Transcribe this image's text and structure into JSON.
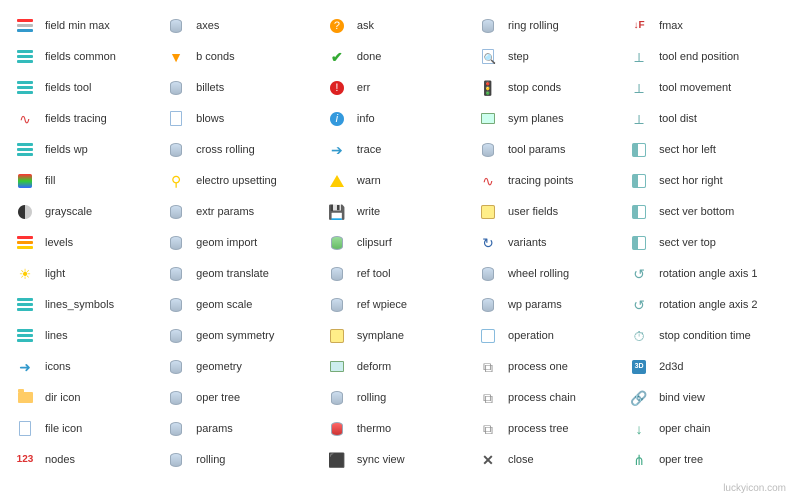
{
  "watermark": "luckyicon.com",
  "columns": [
    [
      {
        "icon": "field-min-max-icon",
        "label": "field min max"
      },
      {
        "icon": "fields-common-icon",
        "label": "fields common"
      },
      {
        "icon": "fields-tool-icon",
        "label": "fields tool"
      },
      {
        "icon": "fields-tracing-icon",
        "label": "fields tracing"
      },
      {
        "icon": "fields-wp-icon",
        "label": "fields wp"
      },
      {
        "icon": "fill-icon",
        "label": "fill"
      },
      {
        "icon": "grayscale-icon",
        "label": "grayscale"
      },
      {
        "icon": "levels-icon",
        "label": "levels"
      },
      {
        "icon": "light-icon",
        "label": "light"
      },
      {
        "icon": "lines-symbols-icon",
        "label": "lines_symbols"
      },
      {
        "icon": "lines-icon",
        "label": "lines"
      },
      {
        "icon": "icons-icon",
        "label": "icons"
      },
      {
        "icon": "dir-icon",
        "label": "dir icon"
      },
      {
        "icon": "file-icon",
        "label": "file icon"
      },
      {
        "icon": "nodes-icon",
        "label": "nodes"
      }
    ],
    [
      {
        "icon": "axes-icon",
        "label": "axes"
      },
      {
        "icon": "b-conds-icon",
        "label": "b conds"
      },
      {
        "icon": "billets-icon",
        "label": "billets"
      },
      {
        "icon": "blows-icon",
        "label": "blows"
      },
      {
        "icon": "cross-rolling-icon",
        "label": "cross rolling"
      },
      {
        "icon": "electro-upsetting-icon",
        "label": "electro upsetting"
      },
      {
        "icon": "extr-params-icon",
        "label": "extr params"
      },
      {
        "icon": "geom-import-icon",
        "label": "geom import"
      },
      {
        "icon": "geom-translate-icon",
        "label": "geom translate"
      },
      {
        "icon": "geom-scale-icon",
        "label": "geom scale"
      },
      {
        "icon": "geom-symmetry-icon",
        "label": "geom symmetry"
      },
      {
        "icon": "geometry-icon",
        "label": "geometry"
      },
      {
        "icon": "oper-tree-icon",
        "label": "oper tree"
      },
      {
        "icon": "params-icon",
        "label": "params"
      },
      {
        "icon": "rolling-icon",
        "label": "rolling"
      }
    ],
    [
      {
        "icon": "ask-icon",
        "label": "ask"
      },
      {
        "icon": "done-icon",
        "label": "done"
      },
      {
        "icon": "err-icon",
        "label": "err"
      },
      {
        "icon": "info-icon",
        "label": "info"
      },
      {
        "icon": "trace-icon",
        "label": "trace"
      },
      {
        "icon": "warn-icon",
        "label": "warn"
      },
      {
        "icon": "write-icon",
        "label": "write"
      },
      {
        "icon": "clipsurf-icon",
        "label": "clipsurf"
      },
      {
        "icon": "ref-tool-icon",
        "label": "ref tool"
      },
      {
        "icon": "ref-wpiece-icon",
        "label": "ref wpiece"
      },
      {
        "icon": "symplane-icon",
        "label": "symplane"
      },
      {
        "icon": "deform-icon",
        "label": "deform"
      },
      {
        "icon": "rolling-2-icon",
        "label": "rolling"
      },
      {
        "icon": "thermo-icon",
        "label": "thermo"
      },
      {
        "icon": "sync-view-icon",
        "label": "sync view"
      }
    ],
    [
      {
        "icon": "ring-rolling-icon",
        "label": "ring rolling"
      },
      {
        "icon": "step-icon",
        "label": "step"
      },
      {
        "icon": "stop-conds-icon",
        "label": "stop conds"
      },
      {
        "icon": "sym-planes-icon",
        "label": "sym planes"
      },
      {
        "icon": "tool-params-icon",
        "label": "tool params"
      },
      {
        "icon": "tracing-points-icon",
        "label": "tracing points"
      },
      {
        "icon": "user-fields-icon",
        "label": "user fields"
      },
      {
        "icon": "variants-icon",
        "label": "variants"
      },
      {
        "icon": "wheel-rolling-icon",
        "label": "wheel rolling"
      },
      {
        "icon": "wp-params-icon",
        "label": "wp params"
      },
      {
        "icon": "operation-icon",
        "label": "operation"
      },
      {
        "icon": "process-one-icon",
        "label": "process one"
      },
      {
        "icon": "process-chain-icon",
        "label": "process chain"
      },
      {
        "icon": "process-tree-icon",
        "label": "process tree"
      },
      {
        "icon": "close-icon",
        "label": "close"
      }
    ],
    [
      {
        "icon": "fmax-icon",
        "label": "fmax"
      },
      {
        "icon": "tool-end-position-icon",
        "label": "tool end position"
      },
      {
        "icon": "tool-movement-icon",
        "label": "tool movement"
      },
      {
        "icon": "tool-dist-icon",
        "label": "tool dist"
      },
      {
        "icon": "sect-hor-left-icon",
        "label": "sect hor left"
      },
      {
        "icon": "sect-hor-right-icon",
        "label": "sect hor right"
      },
      {
        "icon": "sect-ver-bottom-icon",
        "label": "sect ver bottom"
      },
      {
        "icon": "sect-ver-top-icon",
        "label": "sect ver top"
      },
      {
        "icon": "rotation-angle-axis-1-icon",
        "label": "rotation angle axis 1"
      },
      {
        "icon": "rotation-angle-axis-2-icon",
        "label": "rotation angle axis 2"
      },
      {
        "icon": "stop-condition-time-icon",
        "label": "stop condition time"
      },
      {
        "icon": "2d3d-icon",
        "label": "2d3d"
      },
      {
        "icon": "bind-view-icon",
        "label": "bind view"
      },
      {
        "icon": "oper-chain-icon",
        "label": "oper chain"
      },
      {
        "icon": "oper-tree-2-icon",
        "label": "oper tree"
      }
    ]
  ]
}
